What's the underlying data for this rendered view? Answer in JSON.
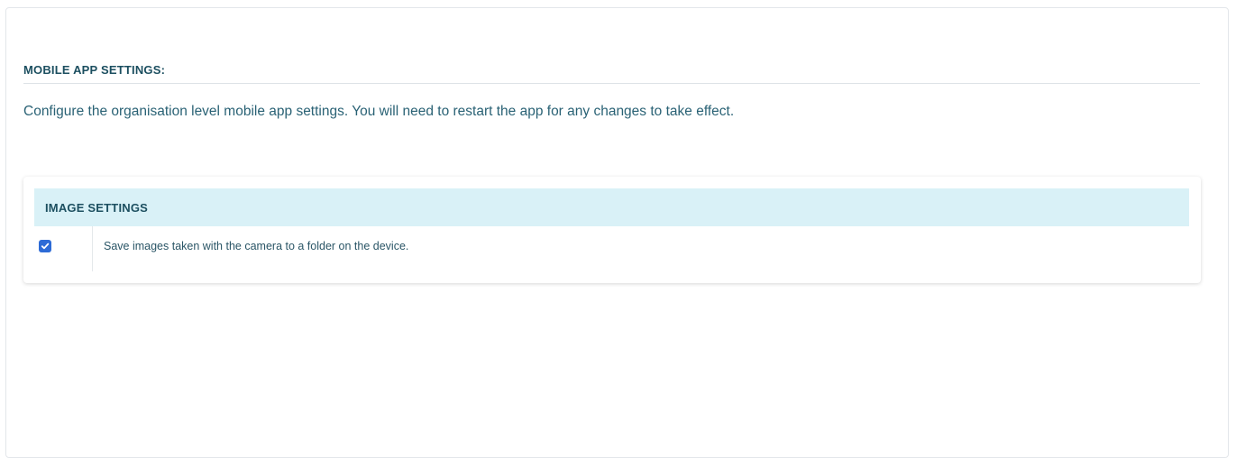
{
  "section": {
    "title": "MOBILE APP SETTINGS:",
    "description": "Configure the organisation level mobile app settings. You will need to restart the app for any changes to take effect."
  },
  "image_settings": {
    "header": "IMAGE SETTINGS",
    "options": [
      {
        "label": "Save images taken with the camera to a folder on the device.",
        "checked": true,
        "icon": "checkmark-icon"
      }
    ]
  },
  "colors": {
    "accent": "#2d6bd6",
    "header_bg": "#d9f1f7",
    "text": "#1c4f60"
  }
}
